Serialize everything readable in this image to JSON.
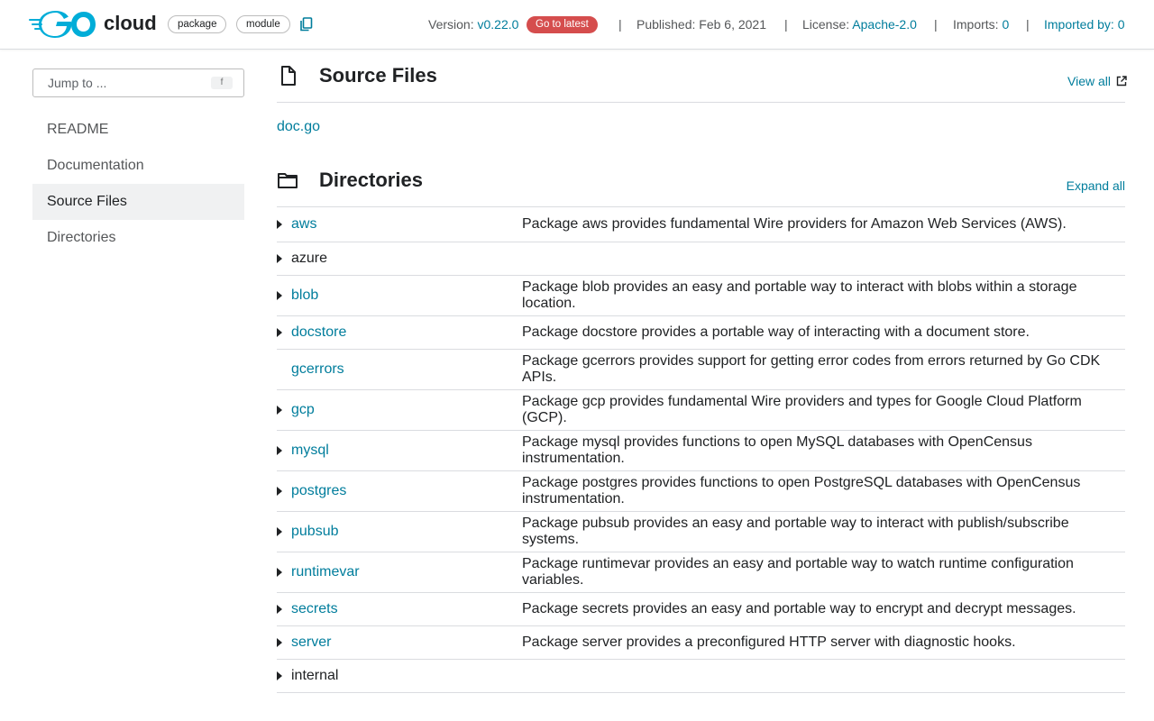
{
  "header": {
    "module_name": "cloud",
    "chips": [
      "package",
      "module"
    ],
    "version_label": "Version:",
    "version_value": "v0.22.0",
    "latest_badge": "Go to latest",
    "published_label": "Published: Feb 6, 2021",
    "license_label": "License:",
    "license_value": "Apache-2.0",
    "imports_label": "Imports:",
    "imports_value": "0",
    "imported_by_label": "Imported by:",
    "imported_by_value": "0",
    "separator": "|"
  },
  "sidebar": {
    "jump_placeholder": "Jump to ...",
    "jump_key": "f",
    "items": [
      {
        "label": "README"
      },
      {
        "label": "Documentation"
      },
      {
        "label": "Source Files"
      },
      {
        "label": "Directories"
      }
    ]
  },
  "source_files": {
    "title": "Source Files",
    "view_all": "View all",
    "files": [
      "doc.go"
    ]
  },
  "directories": {
    "title": "Directories",
    "expand_all": "Expand all",
    "rows": [
      {
        "name": "aws",
        "desc": "Package aws provides fundamental Wire providers for Amazon Web Services (AWS)."
      },
      {
        "name": "azure",
        "desc": ""
      },
      {
        "name": "blob",
        "desc": "Package blob provides an easy and portable way to interact with blobs within a storage location."
      },
      {
        "name": "docstore",
        "desc": "Package docstore provides a portable way of interacting with a document store."
      },
      {
        "name": "gcerrors",
        "desc": "Package gcerrors provides support for getting error codes from errors returned by Go CDK APIs."
      },
      {
        "name": "gcp",
        "desc": "Package gcp provides fundamental Wire providers and types for Google Cloud Platform (GCP)."
      },
      {
        "name": "mysql",
        "desc": "Package mysql provides functions to open MySQL databases with OpenCensus instrumentation."
      },
      {
        "name": "postgres",
        "desc": "Package postgres provides functions to open PostgreSQL databases with OpenCensus instrumentation."
      },
      {
        "name": "pubsub",
        "desc": "Package pubsub provides an easy and portable way to interact with publish/subscribe systems."
      },
      {
        "name": "runtimevar",
        "desc": "Package runtimevar provides an easy and portable way to watch runtime configuration variables."
      },
      {
        "name": "secrets",
        "desc": "Package secrets provides an easy and portable way to encrypt and decrypt messages."
      },
      {
        "name": "server",
        "desc": "Package server provides a preconfigured HTTP server with diagnostic hooks."
      },
      {
        "name": "internal",
        "desc": ""
      }
    ]
  },
  "colors": {
    "link": "#007d9c",
    "badge": "#d54d4d",
    "logo": "#00add8"
  }
}
